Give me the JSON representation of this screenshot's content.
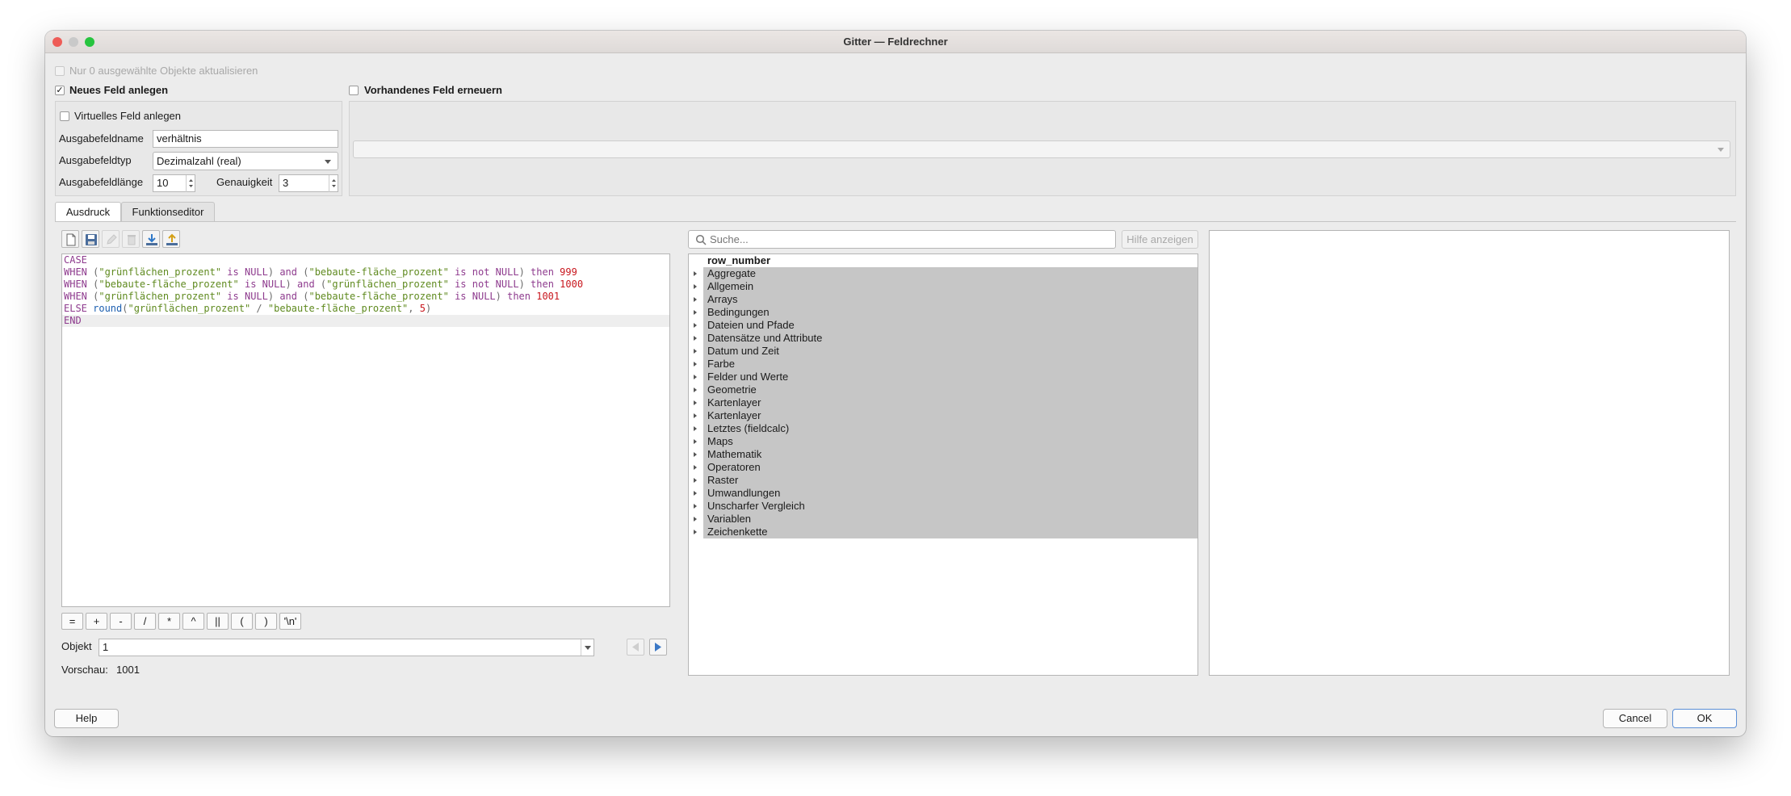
{
  "window": {
    "title": "Gitter — Feldrechner"
  },
  "top": {
    "only_selected_label": "Nur 0 ausgewählte Objekte aktualisieren",
    "new_field_label": "Neues Feld anlegen",
    "update_field_label": "Vorhandenes Feld erneuern"
  },
  "new_field": {
    "virtual_label": "Virtuelles Feld anlegen",
    "name_label": "Ausgabefeldname",
    "name_value": "verhältnis",
    "type_label": "Ausgabefeldtyp",
    "type_value": "Dezimalzahl (real)",
    "length_label": "Ausgabefeldlänge",
    "length_value": "10",
    "precision_label": "Genauigkeit",
    "precision_value": "3"
  },
  "tabs": [
    "Ausdruck",
    "Funktionseditor"
  ],
  "editor": {
    "toolbar_icons": [
      "new-file-icon",
      "save-icon",
      "edit-icon",
      "delete-icon",
      "import-icon",
      "export-icon"
    ],
    "lines": [
      [
        {
          "c": "kw",
          "t": "CASE"
        }
      ],
      [
        {
          "c": "kw",
          "t": "WHEN"
        },
        {
          "c": "op",
          "t": " ("
        },
        {
          "c": "st",
          "t": "\"grünflächen_prozent\""
        },
        {
          "c": "kw",
          "t": " is NULL"
        },
        {
          "c": "op",
          "t": ") "
        },
        {
          "c": "kw",
          "t": "and"
        },
        {
          "c": "op",
          "t": " ("
        },
        {
          "c": "st",
          "t": "\"bebaute-fläche_prozent\""
        },
        {
          "c": "kw",
          "t": " is not NULL"
        },
        {
          "c": "op",
          "t": ") "
        },
        {
          "c": "kw",
          "t": "then "
        },
        {
          "c": "nm",
          "t": "999"
        }
      ],
      [
        {
          "c": "kw",
          "t": "WHEN"
        },
        {
          "c": "op",
          "t": " ("
        },
        {
          "c": "st",
          "t": "\"bebaute-fläche_prozent\""
        },
        {
          "c": "kw",
          "t": " is NULL"
        },
        {
          "c": "op",
          "t": ") "
        },
        {
          "c": "kw",
          "t": "and"
        },
        {
          "c": "op",
          "t": " ("
        },
        {
          "c": "st",
          "t": "\"grünflächen_prozent\""
        },
        {
          "c": "kw",
          "t": " is not NULL"
        },
        {
          "c": "op",
          "t": ") "
        },
        {
          "c": "kw",
          "t": "then "
        },
        {
          "c": "nm",
          "t": "1000"
        }
      ],
      [
        {
          "c": "kw",
          "t": "WHEN"
        },
        {
          "c": "op",
          "t": " ("
        },
        {
          "c": "st",
          "t": "\"grünflächen_prozent\""
        },
        {
          "c": "kw",
          "t": " is NULL"
        },
        {
          "c": "op",
          "t": ") "
        },
        {
          "c": "kw",
          "t": "and"
        },
        {
          "c": "op",
          "t": " ("
        },
        {
          "c": "st",
          "t": "\"bebaute-fläche_prozent\""
        },
        {
          "c": "kw",
          "t": " is NULL"
        },
        {
          "c": "op",
          "t": ") "
        },
        {
          "c": "kw",
          "t": "then "
        },
        {
          "c": "nm",
          "t": "1001"
        }
      ],
      [
        {
          "c": "kw",
          "t": "ELSE "
        },
        {
          "c": "fn",
          "t": "round"
        },
        {
          "c": "op",
          "t": "("
        },
        {
          "c": "st",
          "t": "\"grünflächen_prozent\""
        },
        {
          "c": "op",
          "t": " / "
        },
        {
          "c": "st",
          "t": "\"bebaute-fläche_prozent\""
        },
        {
          "c": "op",
          "t": ", "
        },
        {
          "c": "nm",
          "t": "5"
        },
        {
          "c": "op",
          "t": ")"
        }
      ],
      [
        {
          "c": "kw",
          "t": "END"
        }
      ]
    ],
    "operators": [
      "=",
      "+",
      "-",
      "/",
      "*",
      "^",
      "||",
      "(",
      ")",
      "'\\n'"
    ],
    "object_label": "Objekt",
    "object_value": "1",
    "preview_label": "Vorschau:",
    "preview_value": "1001"
  },
  "functions": {
    "search_placeholder": "Suche...",
    "help_button": "Hilfe anzeigen",
    "items": [
      "row_number",
      "Aggregate",
      "Allgemein",
      "Arrays",
      "Bedingungen",
      "Dateien und Pfade",
      "Datensätze und Attribute",
      "Datum und Zeit",
      "Farbe",
      "Felder und Werte",
      "Geometrie",
      "Kartenlayer",
      "Kartenlayer",
      "Letztes (fieldcalc)",
      "Maps",
      "Mathematik",
      "Operatoren",
      "Raster",
      "Umwandlungen",
      "Unscharfer Vergleich",
      "Variablen",
      "Zeichenkette"
    ]
  },
  "buttons": {
    "help": "Help",
    "cancel": "Cancel",
    "ok": "OK"
  },
  "colors": {
    "keyword": "#8e3b8e",
    "function": "#1c5fb0",
    "string": "#5f8a1f",
    "number": "#c8161d",
    "tree_highlight": "#c6c6c6",
    "close_light": "#ee5c57",
    "minimize_light": "#c9c9c9",
    "zoom_light": "#27c43f"
  }
}
